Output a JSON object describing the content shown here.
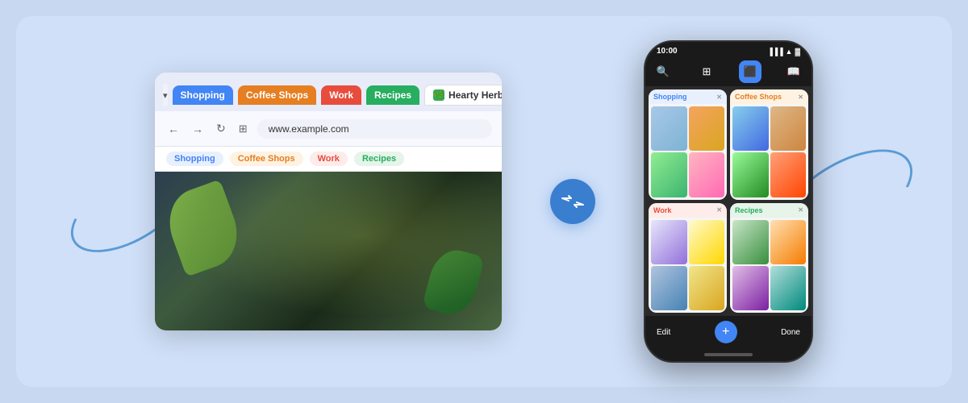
{
  "scene": {
    "background_color": "#d0e0f8"
  },
  "browser": {
    "tabs": [
      {
        "label": "Shopping",
        "class": "tab-shopping"
      },
      {
        "label": "Coffee Shops",
        "class": "tab-coffee"
      },
      {
        "label": "Work",
        "class": "tab-work"
      },
      {
        "label": "Recipes",
        "class": "tab-recipes"
      },
      {
        "label": "Hearty Herb",
        "class": "tab-hearty",
        "active": true
      }
    ],
    "address": "www.example.com",
    "groups": [
      {
        "label": "Shopping",
        "class": "pill-shopping"
      },
      {
        "label": "Coffee Shops",
        "class": "pill-coffee"
      },
      {
        "label": "Work",
        "class": "pill-work"
      },
      {
        "label": "Recipes",
        "class": "pill-recipes"
      }
    ]
  },
  "sync_icon": "⇄",
  "phone": {
    "status_time": "10:00",
    "toolbar_icons": [
      "search",
      "groups",
      "tabs",
      "bookmarks"
    ],
    "tab_groups": [
      {
        "label": "Shopping",
        "header_class": "header-shopping",
        "thumbs": [
          "t1",
          "t2",
          "t3",
          "t4"
        ]
      },
      {
        "label": "Coffee Shops",
        "header_class": "header-coffee",
        "thumbs": [
          "t5",
          "t6",
          "t7",
          "t8"
        ]
      },
      {
        "label": "Work",
        "header_class": "header-work",
        "thumbs": [
          "t9",
          "t10",
          "t11",
          "t12"
        ]
      },
      {
        "label": "Recipes",
        "header_class": "header-recipes",
        "thumbs": [
          "t13",
          "t14",
          "t15",
          "t16"
        ]
      }
    ],
    "bottom_bar": {
      "edit_label": "Edit",
      "done_label": "Done",
      "add_icon": "+"
    }
  }
}
